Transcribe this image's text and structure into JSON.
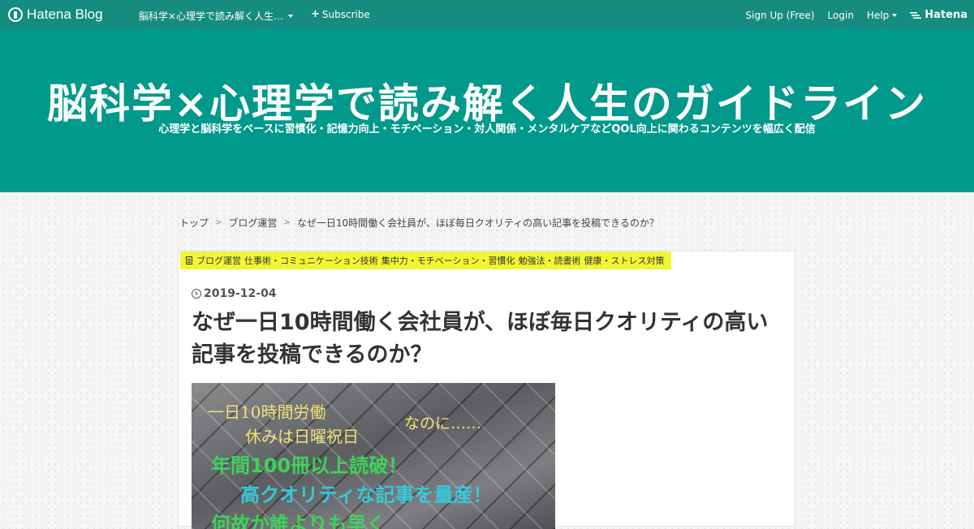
{
  "topbar": {
    "logo_text": "Hatena Blog",
    "blog_select_label": "脳科学×心理学で読み解く人生…",
    "subscribe_label": "Subscribe",
    "signup_label": "Sign Up (Free)",
    "login_label": "Login",
    "help_label": "Help",
    "brand_label": "Hatena"
  },
  "header": {
    "title": "脳科学×心理学で読み解く人生のガイドライン",
    "description": "心理学と脳科学をベースに習慣化・記憶力向上・モチベーション・対人関係・メンタルケアなどQOL向上に関わるコンテンツを幅広く配信"
  },
  "breadcrumb": {
    "items": [
      "トップ",
      "ブログ運営",
      "なぜ一日10時間働く会社員が、ほぼ毎日クオリティの高い記事を投稿できるのか？"
    ],
    "separator": ">"
  },
  "article": {
    "categories": [
      "ブログ運営",
      "仕事術・コミュニケーション技術",
      "集中力・モチベーション・習慣化",
      "勉強法・読書術",
      "健康・ストレス対策"
    ],
    "date": "2019-12-04",
    "title": "なぜ一日10時間働く会社員が、ほぼ毎日クオリティの高い記事を投稿できるのか？",
    "eyecatch": {
      "line1": "一日10時間労働",
      "line2": "休みは日曜祝日",
      "line3": "なのに……",
      "line4": "年間100冊以上読破！",
      "line5": "高クオリティな記事を量産！",
      "line6": "何故か誰よりも早く"
    }
  },
  "colors": {
    "topbar_bg": "#168b80",
    "header_bg": "#00998b",
    "category_highlight": "#f1f633",
    "page_bg": "#f5f5f5"
  }
}
